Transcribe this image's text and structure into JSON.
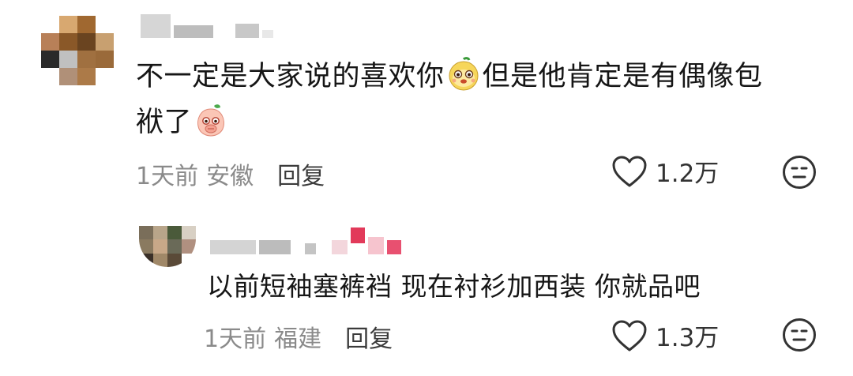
{
  "comments": [
    {
      "text_line1_a": "不一定是大家说的喜欢你",
      "emoji_1": "yellow-monkey-face-emoji",
      "text_line1_b": "但是他肯定是有偶像包",
      "text_line2": "袱了",
      "emoji_2": "peach-shy-face-emoji",
      "time": "1天前",
      "location": "安徽",
      "reply_label": "回复",
      "likes": "1.2万"
    }
  ],
  "replies": [
    {
      "text": "以前短袖塞裤裆 现在衬衫加西装 你就品吧",
      "time": "1天前",
      "location": "福建",
      "reply_label": "回复",
      "likes": "1.3万"
    }
  ],
  "icons": {
    "like": "heart-outline-icon",
    "dislike": "neutral-face-icon"
  },
  "colors": {
    "text": "#161616",
    "meta": "#8a8a8a",
    "reply_link": "#3b3b3b"
  }
}
